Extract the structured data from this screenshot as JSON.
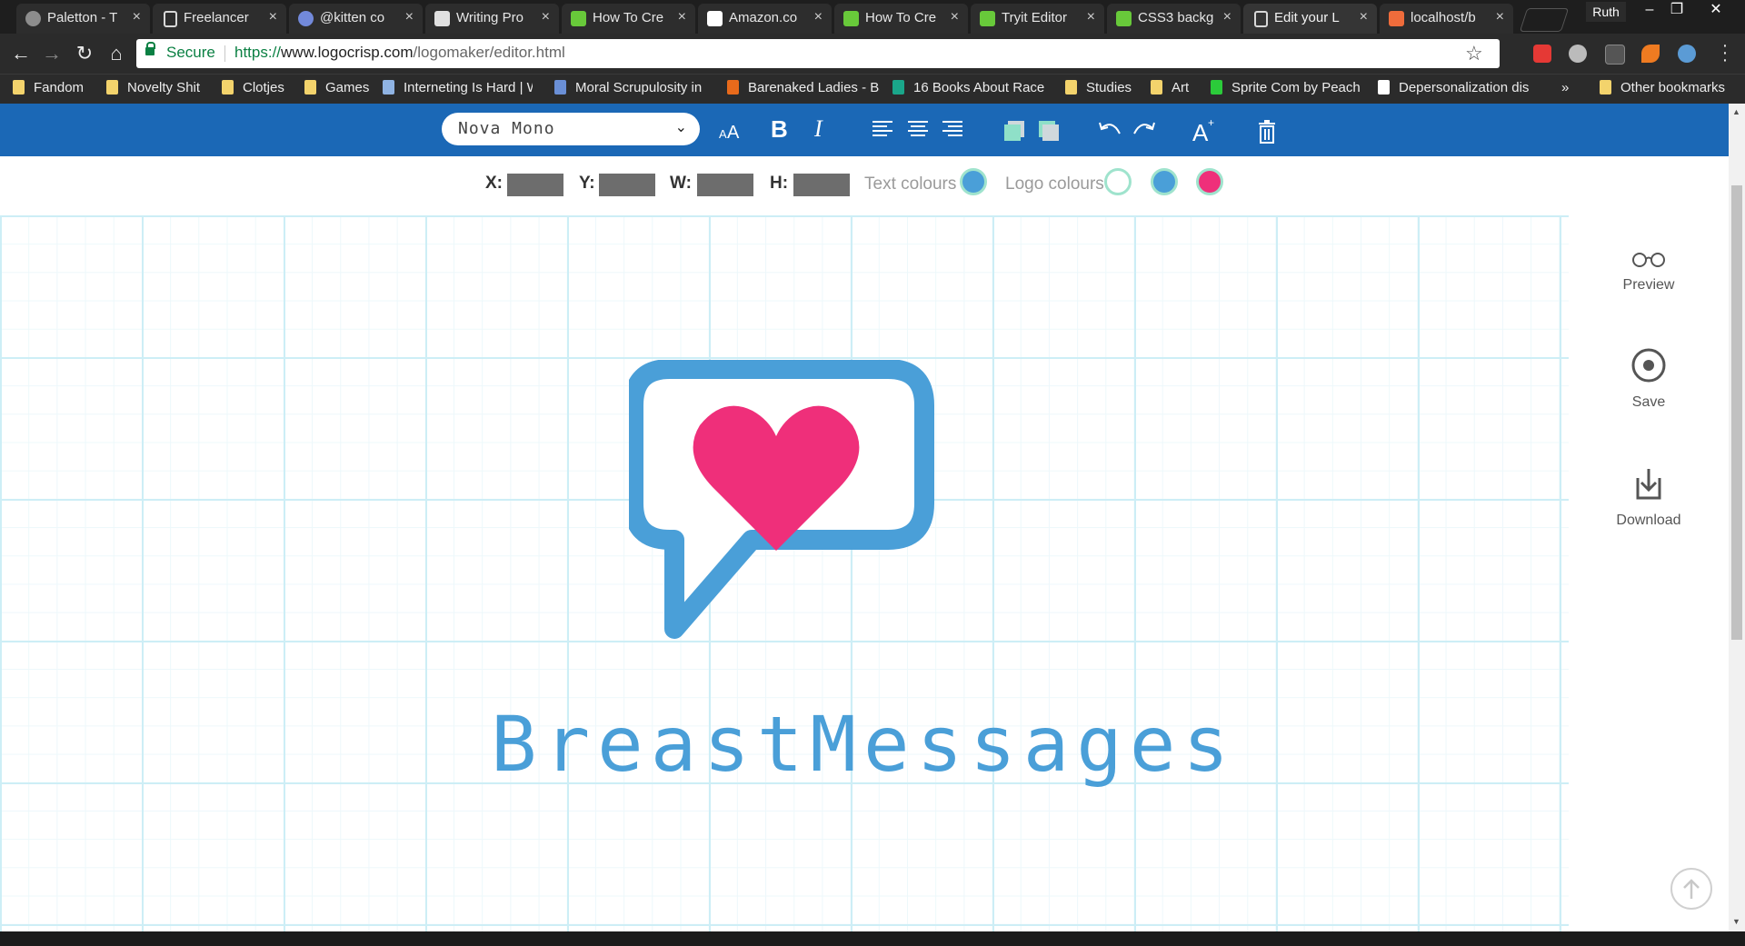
{
  "browser": {
    "tabs": [
      {
        "title": "Paletton - T",
        "icon_color": "#8d8d8d"
      },
      {
        "title": "Freelancer",
        "icon_color": "#d8d8d8"
      },
      {
        "title": "@kitten co",
        "icon_color": "#7289da"
      },
      {
        "title": "Writing Pro",
        "icon_color": "#e0e0e0"
      },
      {
        "title": "How To Cre",
        "icon_color": "#68c93a"
      },
      {
        "title": "Amazon.co",
        "icon_color": "#ffffff"
      },
      {
        "title": "How To Cre",
        "icon_color": "#68c93a"
      },
      {
        "title": "Tryit Editor",
        "icon_color": "#68c93a"
      },
      {
        "title": "CSS3 backg",
        "icon_color": "#68c93a"
      },
      {
        "title": "Edit your L",
        "icon_color": "#d8d8d8"
      },
      {
        "title": "localhost/b",
        "icon_color": "#ef6c3b"
      }
    ],
    "active_tab_index": 9,
    "tab_close_glyph": "×",
    "profile_name": "Ruth",
    "window_controls": {
      "minimize": "–",
      "restore": "❐",
      "close": "✕"
    },
    "nav": {
      "back": "←",
      "forward": "→",
      "reload": "↻",
      "home": "⌂"
    },
    "address": {
      "secure_label": "Secure",
      "url_scheme": "https://",
      "url_host": "www.logocrisp.com",
      "url_path": "/logomaker/editor.html",
      "bookmark_star": "☆"
    },
    "bookmarks": [
      {
        "label": "Fandom",
        "icon": "folder"
      },
      {
        "label": "Novelty Shit",
        "icon": "folder"
      },
      {
        "label": "Clotjes",
        "icon": "folder"
      },
      {
        "label": "Games",
        "icon": "folder"
      },
      {
        "label": "Interneting Is Hard | W",
        "icon": "site"
      },
      {
        "label": "Moral Scrupulosity in",
        "icon": "site"
      },
      {
        "label": "Barenaked Ladies - Ba",
        "icon": "site"
      },
      {
        "label": "16 Books About Race",
        "icon": "site"
      },
      {
        "label": "Studies",
        "icon": "folder"
      },
      {
        "label": "Art",
        "icon": "folder"
      },
      {
        "label": "Sprite Com by Peach",
        "icon": "site"
      },
      {
        "label": "Depersonalization dis",
        "icon": "site"
      }
    ],
    "bookmarks_overflow": "»",
    "other_bookmarks": "Other bookmarks"
  },
  "editor": {
    "toolbar": {
      "font_value": "Nova Mono",
      "font_dropdown_arrow": "⌄",
      "bold_glyph": "B",
      "italic_glyph": "I",
      "icons": [
        "font-size-icon",
        "bold-icon",
        "italic-icon",
        "align-left-icon",
        "align-center-icon",
        "align-right-icon",
        "bring-forward-icon",
        "send-backward-icon",
        "undo-icon",
        "redo-icon",
        "add-text-icon",
        "delete-icon"
      ],
      "bar_color": "#1b68b6"
    },
    "props": {
      "x_label": "X:",
      "y_label": "Y:",
      "w_label": "W:",
      "h_label": "H:",
      "text_colours_label": "Text colours",
      "logo_colours_label": "Logo colours",
      "text_colours": [
        "#4a9fd8"
      ],
      "logo_colours": [
        "#ffffff",
        "#4a9fd8",
        "#ef2f7a"
      ]
    },
    "logo": {
      "text": "BreastMessages",
      "text_color": "#4a9fd8",
      "bubble_color": "#4a9fd8",
      "heart_color": "#ef2f7a"
    },
    "side_panel": {
      "preview_label": "Preview",
      "save_label": "Save",
      "download_label": "Download"
    }
  }
}
